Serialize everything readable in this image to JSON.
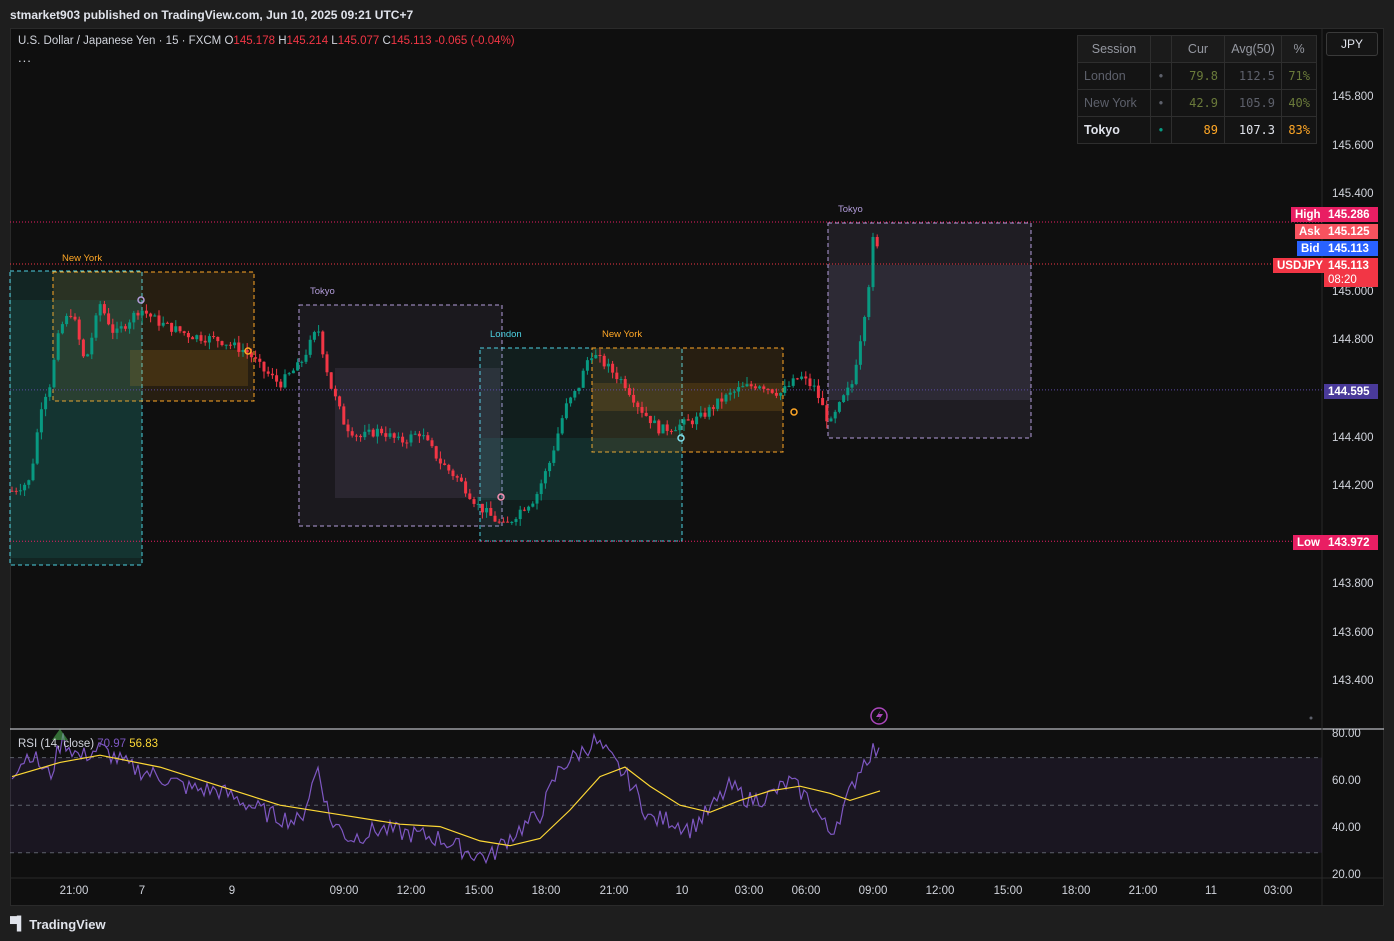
{
  "header": {
    "publisher": "stmarket903 published on TradingView.com, Jun 10, 2025 09:21 UTC+7"
  },
  "footer": {
    "brand": "TradingView"
  },
  "legend": {
    "symbol": "U.S. Dollar / Japanese Yen · 15 · FXCM",
    "o_label": "O",
    "o": "145.178",
    "h_label": "H",
    "h": "145.214",
    "l_label": "L",
    "l": "145.077",
    "c_label": "C",
    "c": "145.113",
    "change": "-0.065 (-0.04%)",
    "more": "..."
  },
  "currency_button": "JPY",
  "session_table": {
    "headers": [
      "Session",
      "Cur",
      "Avg(50)",
      "%"
    ],
    "rows": [
      {
        "session": "London",
        "dot": "•",
        "cur": "79.8",
        "avg": "112.5",
        "pct": "71%"
      },
      {
        "session": "New York",
        "dot": "•",
        "cur": "42.9",
        "avg": "105.9",
        "pct": "40%"
      },
      {
        "session": "Tokyo",
        "dot": "•",
        "cur": "89",
        "avg": "107.3",
        "pct": "83%"
      }
    ]
  },
  "price_axis": [
    "145.800",
    "145.600",
    "145.400",
    "145.000",
    "144.800",
    "144.400",
    "144.200",
    "143.800",
    "143.600",
    "143.400"
  ],
  "price_tags": {
    "high_label": "High",
    "high": "145.286",
    "ask_label": "Ask",
    "ask": "145.125",
    "bid_label": "Bid",
    "bid": "145.113",
    "sym_label": "USDJPY",
    "last": "145.113",
    "countdown": "08:20",
    "level": "144.595",
    "low_label": "Low",
    "low": "143.972"
  },
  "rsi": {
    "label": "RSI (14, close)",
    "value": "70.97",
    "ma_value": "56.83",
    "axis": [
      "80.00",
      "60.00",
      "40.00",
      "20.00"
    ]
  },
  "time_axis": [
    "21:00",
    "7",
    "9",
    "09:00",
    "12:00",
    "15:00",
    "18:00",
    "21:00",
    "10",
    "03:00",
    "06:00",
    "09:00",
    "12:00",
    "15:00",
    "18:00",
    "21:00",
    "11",
    "03:00"
  ],
  "session_labels": [
    "New York",
    "Tokyo",
    "London",
    "New York",
    "Tokyo"
  ],
  "colors": {
    "up": "#089981",
    "down": "#f23645",
    "tokyo": "#b39ddb",
    "london": "#4dd0e1",
    "newyork": "#ffa726",
    "rsi_line": "#7e57c2",
    "rsi_ma": "#fdd835",
    "high_tag": "#e91e63",
    "ask_tag": "#f7525f",
    "bid_tag": "#2962ff",
    "level_tag": "#4a3a9a"
  },
  "icons": {
    "flash": "flash-icon",
    "logo": "tradingview-logo-icon"
  }
}
